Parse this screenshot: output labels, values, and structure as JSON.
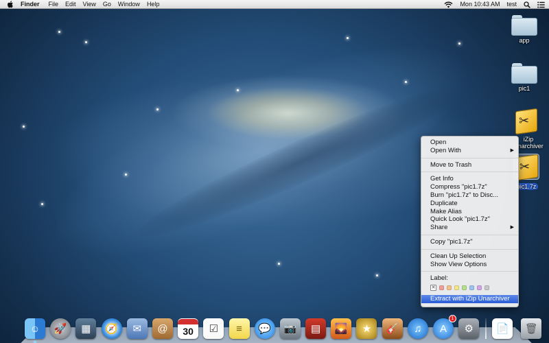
{
  "menubar": {
    "app_name": "Finder",
    "menus": [
      "File",
      "Edit",
      "View",
      "Go",
      "Window",
      "Help"
    ],
    "clock": "Mon 10:43 AM",
    "user": "test",
    "status_icons": [
      "wifi-icon",
      "spotlight-icon",
      "notification-center-icon"
    ]
  },
  "desktop_icons": [
    {
      "label": "app",
      "kind": "folder"
    },
    {
      "label": "pic1",
      "kind": "folder"
    },
    {
      "label": "iZip Unarchiver",
      "kind": "application"
    },
    {
      "label": "pic1.7z",
      "kind": "archive",
      "selected": true
    }
  ],
  "context_menu": {
    "group1": [
      "Open",
      "Open With"
    ],
    "group2": [
      "Move to Trash"
    ],
    "group3": [
      "Get Info",
      "Compress \"pic1.7z\"",
      "Burn \"pic1.7z\" to Disc...",
      "Duplicate",
      "Make Alias",
      "Quick Look \"pic1.7z\"",
      "Share"
    ],
    "group4": [
      "Copy \"pic1.7z\""
    ],
    "group5": [
      "Clean Up Selection",
      "Show View Options"
    ],
    "label_title": "Label:",
    "label_colors": [
      "#f0a09a",
      "#f2c08a",
      "#f4e58a",
      "#b6e08e",
      "#9cc2f0",
      "#d2a6e8",
      "#c8c8c8"
    ],
    "highlighted_item": "Extract with iZip Unarchiver"
  },
  "dock": {
    "apps": [
      "Finder",
      "Launchpad",
      "Mission Control",
      "Safari",
      "Mail",
      "Contacts",
      "Calendar",
      "Reminders",
      "Notes",
      "Messages",
      "FaceTime",
      "Photo Booth",
      "iPhoto",
      "iMovie",
      "GarageBand",
      "iTunes",
      "App Store",
      "System Preferences"
    ],
    "calendar_day": "30",
    "app_store_badge": "1",
    "stack_items": [
      "Documents",
      "Trash"
    ]
  },
  "colors": {
    "selection_blue": "#2a5dd6",
    "menubar_bg": "#e8e8e8"
  }
}
